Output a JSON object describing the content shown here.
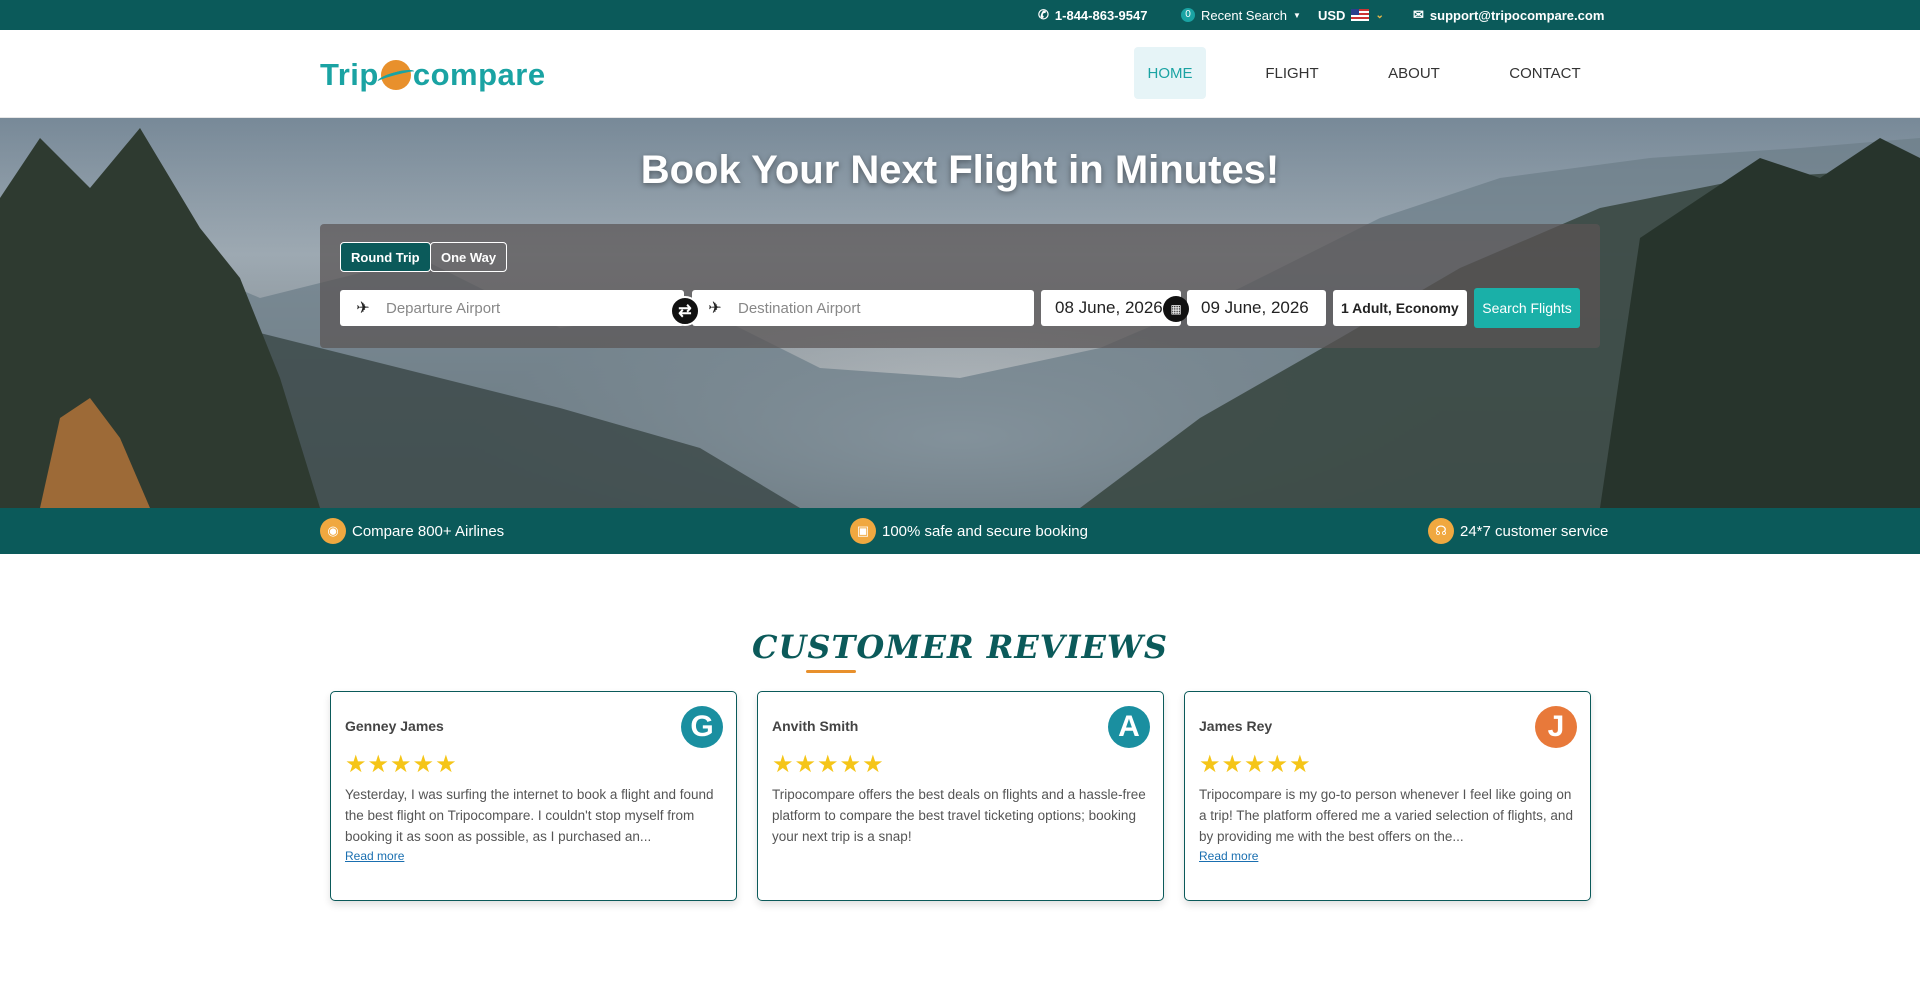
{
  "topbar": {
    "phone": "1-844-863-9547",
    "recent_count": "0",
    "recent_label": "Recent Search",
    "currency": "USD",
    "email": "support@tripocompare.com"
  },
  "header": {
    "logo_left": "Trip",
    "logo_right": "compare",
    "nav": [
      {
        "label": "HOME"
      },
      {
        "label": "FLIGHT"
      },
      {
        "label": "ABOUT"
      },
      {
        "label": "CONTACT"
      }
    ]
  },
  "hero": {
    "title": "Book Your Next Flight in Minutes!",
    "trip_types": [
      "Round Trip",
      "One Way"
    ],
    "departure_placeholder": "Departure Airport",
    "destination_placeholder": "Destination Airport",
    "depart_date": "08 June, 2026",
    "return_date": "09 June, 2026",
    "passengers": "1 Adult, Economy",
    "search_label": "Search Flights"
  },
  "features": [
    {
      "label": "Compare 800+ Airlines",
      "icon": "globe-icon"
    },
    {
      "label": "100% safe and secure booking",
      "icon": "lock-icon"
    },
    {
      "label": "24*7 customer service",
      "icon": "headset-icon"
    }
  ],
  "reviews": {
    "title": "CUSTOMER REVIEWS",
    "items": [
      {
        "name": "Genney James",
        "initial": "G",
        "color": "#1a8fa0",
        "stars": "★★★★★",
        "text": "Yesterday, I was surfing the internet to book a flight and found the best flight on Tripocompare. I couldn't stop myself from booking it as soon as possible, as I purchased an...",
        "more": "Read more"
      },
      {
        "name": "Anvith Smith",
        "initial": "A",
        "color": "#1a8fa0",
        "stars": "★★★★★",
        "text": "Tripocompare offers the best deals on flights and a hassle-free platform to compare the best travel ticketing options; booking your next trip is a snap!",
        "more": ""
      },
      {
        "name": "James Rey",
        "initial": "J",
        "color": "#e8793a",
        "stars": "★★★★★",
        "text": "Tripocompare is my go-to person whenever I feel like going on a trip! The platform offered me a varied selection of flights, and by providing me with the best offers on the...",
        "more": "Read more"
      }
    ]
  }
}
